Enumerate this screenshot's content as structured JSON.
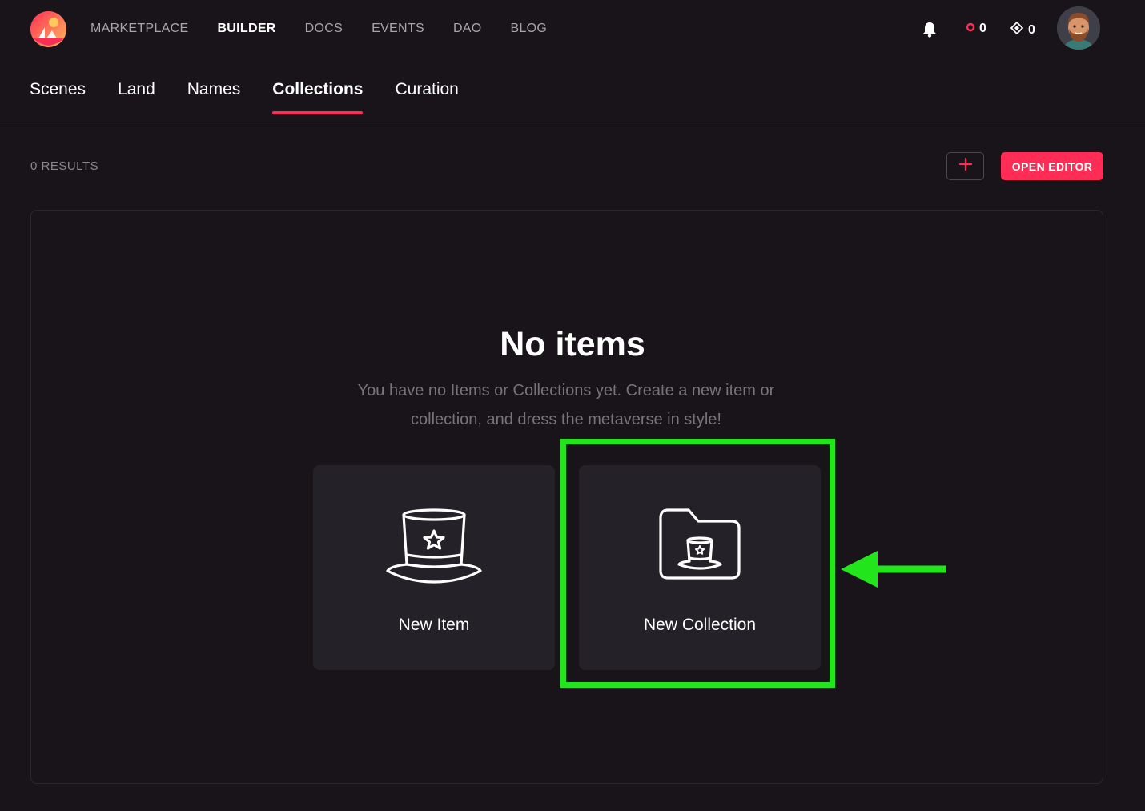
{
  "topbar": {
    "nav": [
      "MARKETPLACE",
      "BUILDER",
      "DOCS",
      "EVENTS",
      "DAO",
      "BLOG"
    ],
    "active_nav": "BUILDER",
    "mana_balance": "0",
    "land_balance": "0",
    "icons": {
      "logo": "decentraland-logo",
      "bell": "bell-icon",
      "mana": "mana-icon",
      "land": "diamond-icon",
      "avatar": "avatar"
    }
  },
  "subnav": {
    "tabs": [
      "Scenes",
      "Land",
      "Names",
      "Collections",
      "Curation"
    ],
    "active_tab": "Collections"
  },
  "toolbar": {
    "results": "0 RESULTS",
    "open_editor": "OPEN EDITOR"
  },
  "empty_state": {
    "title": "No items",
    "description": "You have no Items or Collections yet. Create a new item or collection, and dress the metaverse in style!"
  },
  "cards": [
    {
      "label": "New Item",
      "icon": "top-hat-icon"
    },
    {
      "label": "New Collection",
      "icon": "folder-hat-icon"
    }
  ],
  "colors": {
    "background": "#18141a",
    "accent": "#ff2d55",
    "card": "#242129",
    "highlight": "#22e61b"
  }
}
